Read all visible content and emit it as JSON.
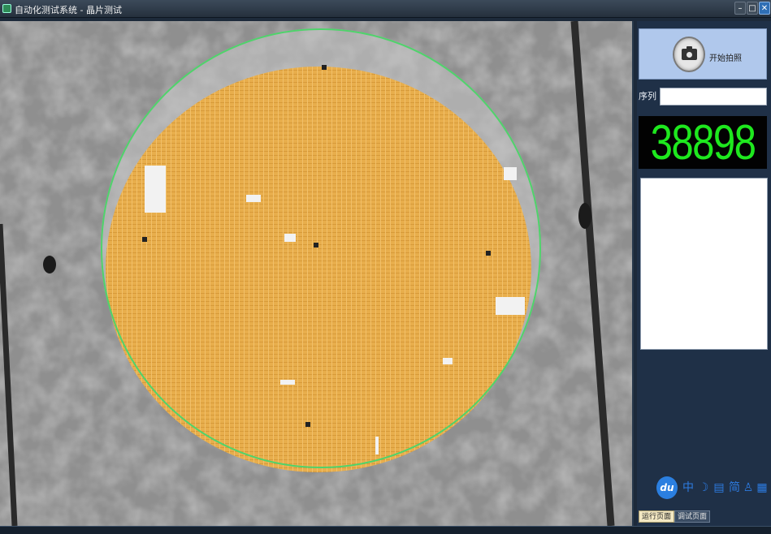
{
  "window": {
    "title": "自动化测试系统 - 晶片测试",
    "minimize_glyph": "–",
    "maximize_glyph": "□",
    "close_glyph": "✕"
  },
  "viewer": {
    "description_colors": {
      "background": "#9b9b9b",
      "wafer_fill": "#e8ae4c",
      "wafer_outline": "#4fd36b"
    }
  },
  "panel": {
    "capture_button_label": "开始拍照",
    "serial_label": "序列",
    "serial_value": "",
    "counter_value": "38898",
    "tabs": [
      {
        "label": "运行页面",
        "active": true
      },
      {
        "label": "调试页面",
        "active": false
      }
    ]
  },
  "ime_toolbar": {
    "logo": "du",
    "items": [
      {
        "name": "chinese-mode-icon",
        "glyph": "中"
      },
      {
        "name": "moon-icon",
        "glyph": "☽"
      },
      {
        "name": "keyboard-icon",
        "glyph": "▤"
      },
      {
        "name": "simplified-icon",
        "glyph": "简"
      },
      {
        "name": "user-icon",
        "glyph": "♙"
      },
      {
        "name": "grid-menu-icon",
        "glyph": "▦"
      }
    ]
  },
  "colors": {
    "accent_green": "#1ee81e",
    "panel_bg": "#1f3047",
    "capture_button_bg": "#b0c8ec"
  }
}
